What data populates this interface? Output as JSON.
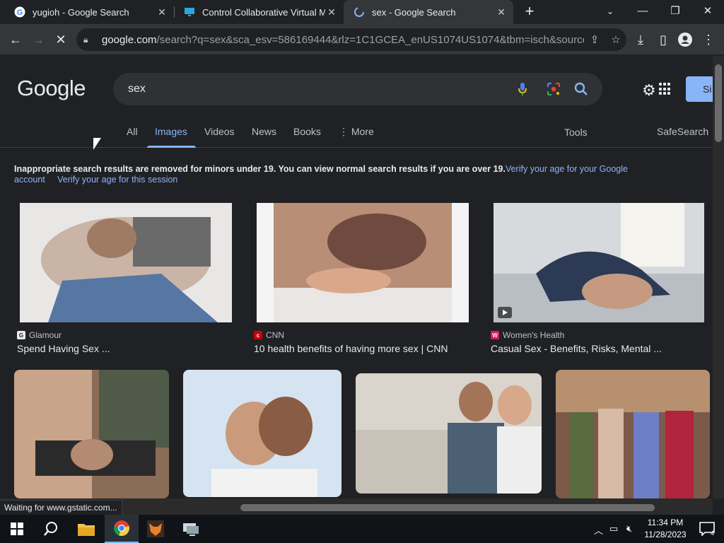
{
  "tabs": [
    {
      "title": "yugioh - Google Search",
      "favicon": "google-g-icon"
    },
    {
      "title": "Control Collaborative Virtual Ma",
      "favicon": "monitor-icon"
    },
    {
      "title": "sex - Google Search",
      "favicon": "loading-icon",
      "active": true
    }
  ],
  "toolbar": {
    "url_domain": "google.com",
    "url_path": "/search?q=sex&sca_esv=586169444&rlz=1C1GCEA_enUS1074US1074&tbm=isch&source=lnm..."
  },
  "google": {
    "logo": "Google",
    "query": "sex",
    "signin_label": "Si",
    "nav": [
      "All",
      "Images",
      "Videos",
      "News",
      "Books",
      "More"
    ],
    "more_label": "More",
    "tools": "Tools",
    "safesearch": "SafeSearch",
    "notice_text": "Inappropriate search results are removed for minors under 19. You can view normal search results if you are over 19.",
    "notice_link1": "Verify your age for your Google account",
    "notice_link2": "Verify your age for this session"
  },
  "results": [
    {
      "source": "Glamour",
      "title": "Spend Having Sex ..."
    },
    {
      "source": "CNN",
      "title": "10 health benefits of having more sex | CNN"
    },
    {
      "source": "Women's Health",
      "title": "Casual Sex - Benefits, Risks, Mental ..."
    }
  ],
  "status_text": "Waiting for www.gstatic.com...",
  "taskbar": {
    "time": "11:34 PM",
    "date": "11/28/2023",
    "notifications": "4"
  },
  "colors": {
    "accent": "#8ab4f8",
    "background": "#202124"
  }
}
